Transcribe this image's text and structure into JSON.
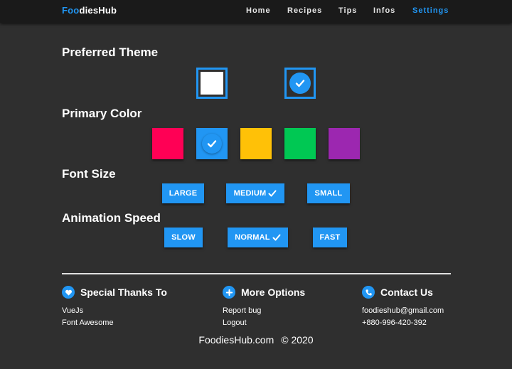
{
  "brand": {
    "prefix": "Foo",
    "suffix": "diesHub"
  },
  "nav": [
    {
      "label": "Home"
    },
    {
      "label": "Recipes"
    },
    {
      "label": "Tips"
    },
    {
      "label": "Infos"
    },
    {
      "label": "Settings",
      "active": true
    }
  ],
  "sections": {
    "theme": "Preferred Theme",
    "color": "Primary Color",
    "font": "Font Size",
    "anim": "Animation Speed"
  },
  "themes": [
    {
      "name": "light",
      "color": "#ffffff",
      "selected": false
    },
    {
      "name": "dark",
      "color": "#2f2f2f",
      "selected": true
    }
  ],
  "colors": [
    {
      "hex": "#ff0055",
      "selected": false
    },
    {
      "hex": "#2196f3",
      "selected": true
    },
    {
      "hex": "#ffc107",
      "selected": false
    },
    {
      "hex": "#00c853",
      "selected": false
    },
    {
      "hex": "#9c27b0",
      "selected": false
    }
  ],
  "font_sizes": [
    {
      "label": "LARGE",
      "selected": false
    },
    {
      "label": "MEDIUM",
      "selected": true
    },
    {
      "label": "SMALL",
      "selected": false
    }
  ],
  "speeds": [
    {
      "label": "SLOW",
      "selected": false
    },
    {
      "label": "NORMAL",
      "selected": true
    },
    {
      "label": "FAST",
      "selected": false
    }
  ],
  "footer": {
    "thanks": {
      "title": "Special Thanks To",
      "icon": "heart-icon",
      "items": [
        "VueJs",
        "Font Awesome"
      ]
    },
    "more": {
      "title": "More Options",
      "icon": "plus-icon",
      "items": [
        "Report bug",
        "Logout"
      ]
    },
    "contact": {
      "title": "Contact Us",
      "icon": "phone-icon",
      "items": [
        "foodieshub@gmail.com",
        "+880-996-420-392"
      ]
    },
    "site": "FoodiesHub.com",
    "year": "© 2020"
  },
  "accent": "#2196f3"
}
